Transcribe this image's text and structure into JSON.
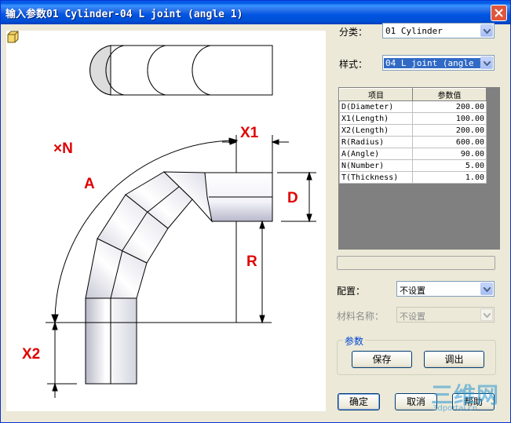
{
  "window": {
    "title": "输入参数01 Cylinder-04 L joint (angle 1)"
  },
  "drawing": {
    "labels": {
      "n": "×N",
      "x1": "X1",
      "a": "A",
      "d": "D",
      "r": "R",
      "x2": "X2"
    },
    "label_color": "#e00000"
  },
  "form": {
    "category_label": "分类：",
    "category_value": "01 Cylinder",
    "style_label": "样式：",
    "style_value": "04 L joint (angle 1)",
    "config_label": "配置：",
    "config_value": "不设置",
    "material_label": "材料名称：",
    "material_value": "不设置"
  },
  "params_table": {
    "headers": [
      "项目",
      "参数值"
    ],
    "rows": [
      [
        "D(Diameter)",
        "200.00"
      ],
      [
        "X1(Length)",
        "100.00"
      ],
      [
        "X2(Length)",
        "200.00"
      ],
      [
        "R(Radius)",
        "600.00"
      ],
      [
        "A(Angle)",
        "90.00"
      ],
      [
        "N(Number)",
        "5.00"
      ],
      [
        "T(Thickness)",
        "1.00"
      ]
    ]
  },
  "params_group": {
    "title": "参数",
    "save_label": "保存",
    "load_label": "调出"
  },
  "footer": {
    "ok_label": "确定",
    "cancel_label": "取消",
    "help_label": "帮助"
  },
  "watermark": {
    "brand": "三维网",
    "url": "3dportal.cn"
  },
  "colors": {
    "titlebar": "#0054e3",
    "accent_selected": "#316ac5",
    "group_title": "#0046d5"
  },
  "icons": [
    "close-icon",
    "dropdown-arrow-icon",
    "cube-icon"
  ]
}
